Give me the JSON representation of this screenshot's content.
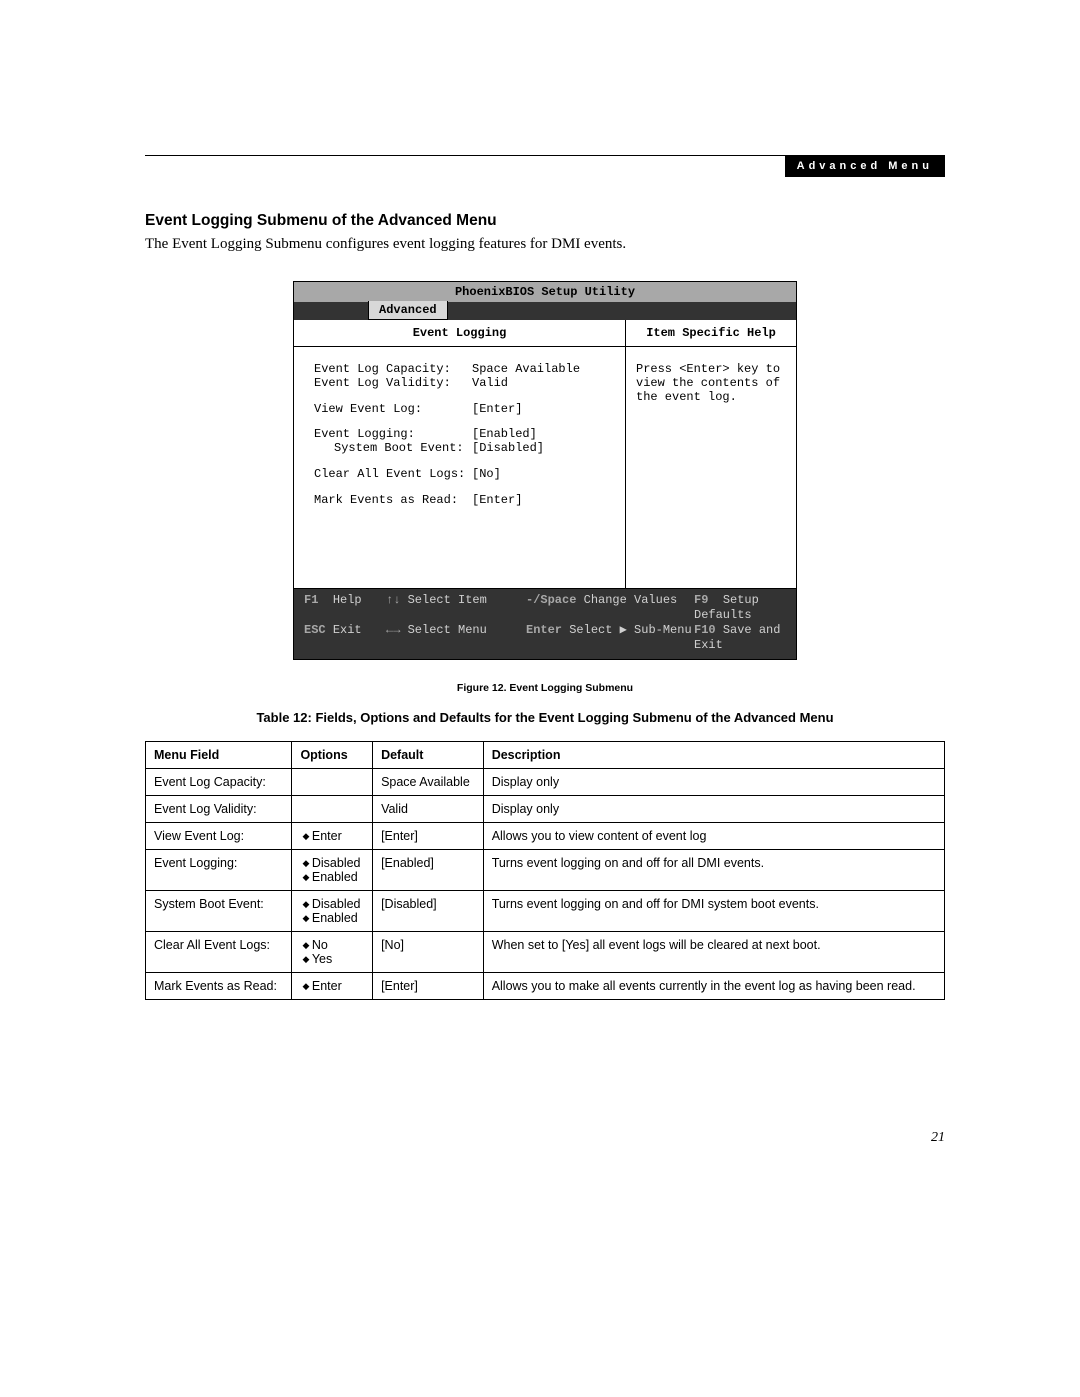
{
  "pageNumber": "21",
  "headerBanner": "Advanced Menu",
  "sectionHeading": "Event Logging Submenu of the Advanced Menu",
  "introText": "The Event Logging Submenu configures event logging features for DMI events.",
  "bios": {
    "title": "PhoenixBIOS Setup Utility",
    "tab": "Advanced",
    "panelHeading": "Event Logging",
    "helpHeading": "Item Specific Help",
    "helpText": "Press <Enter> key to view the contents of the event log.",
    "items": [
      {
        "label": "Event Log Capacity:",
        "value": "Space Available",
        "indent": false,
        "gapAfter": false
      },
      {
        "label": "Event Log Validity:",
        "value": "Valid",
        "indent": false,
        "gapAfter": true
      },
      {
        "label": "View Event Log:",
        "value": "[Enter]",
        "indent": false,
        "gapAfter": true
      },
      {
        "label": "Event Logging:",
        "value": "[Enabled]",
        "indent": false,
        "gapAfter": false
      },
      {
        "label": "System Boot Event:",
        "value": "[Disabled]",
        "indent": true,
        "gapAfter": true
      },
      {
        "label": "Clear All Event Logs:",
        "value": "[No]",
        "indent": false,
        "gapAfter": true
      },
      {
        "label": "Mark Events as Read:",
        "value": "[Enter]",
        "indent": false,
        "gapAfter": false
      }
    ],
    "footer": {
      "row1": {
        "c1k": "F1",
        "c1t": "Help",
        "c2k": "↑↓",
        "c2t": "Select Item",
        "c3k": "-/Space",
        "c3t": "Change Values",
        "c4k": "F9",
        "c4t": "Setup Defaults"
      },
      "row2": {
        "c1k": "ESC",
        "c1t": "Exit",
        "c2k": "←→",
        "c2t": "Select Menu",
        "c3k": "Enter",
        "c3t": "Select ▶ Sub-Menu",
        "c4k": "F10",
        "c4t": "Save and Exit"
      }
    }
  },
  "figureCaption": "Figure 12.  Event Logging Submenu",
  "tableCaption": "Table 12: Fields, Options and Defaults for the Event Logging Submenu of the Advanced Menu",
  "table": {
    "headers": [
      "Menu Field",
      "Options",
      "Default",
      "Description"
    ],
    "rows": [
      {
        "field": "Event Log Capacity:",
        "options": [],
        "default": "Space Available",
        "desc": "Display only"
      },
      {
        "field": "Event Log Validity:",
        "options": [],
        "default": "Valid",
        "desc": "Display only"
      },
      {
        "field": "View Event Log:",
        "options": [
          "Enter"
        ],
        "default": "[Enter]",
        "desc": "Allows you to view content of event log"
      },
      {
        "field": "Event Logging:",
        "options": [
          "Disabled",
          "Enabled"
        ],
        "default": "[Enabled]",
        "desc": "Turns event logging on and off for all DMI events."
      },
      {
        "field": "System Boot Event:",
        "options": [
          "Disabled",
          "Enabled"
        ],
        "default": "[Disabled]",
        "desc": "Turns event logging on and off for DMI system boot events."
      },
      {
        "field": "Clear All Event Logs:",
        "options": [
          "No",
          "Yes"
        ],
        "default": "[No]",
        "desc": "When set to [Yes] all event logs will be cleared at next boot."
      },
      {
        "field": "Mark Events as Read:",
        "options": [
          "Enter"
        ],
        "default": "[Enter]",
        "desc": "Allows you to make all events currently in the event log as having been read."
      }
    ]
  }
}
